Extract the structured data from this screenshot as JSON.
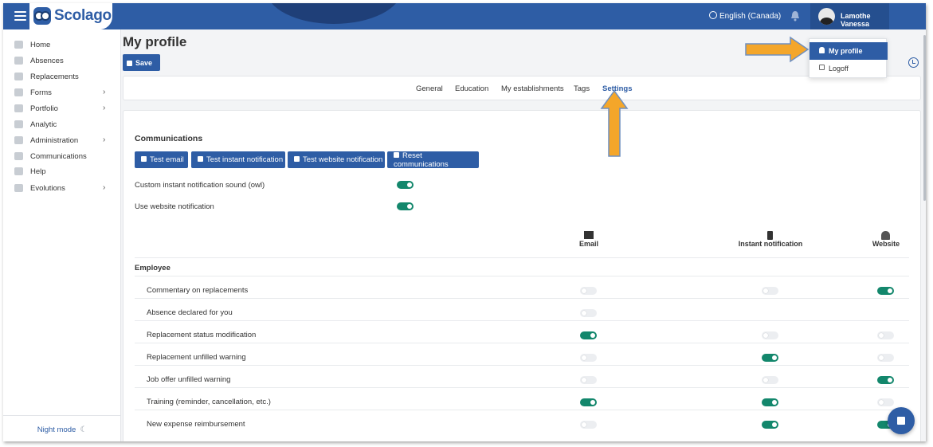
{
  "header": {
    "brand": "Scolago",
    "language": "English (Canada)",
    "user_name": "Lamothe Vanessa"
  },
  "user_menu": {
    "items": [
      {
        "label": "My profile",
        "icon": "user-icon",
        "active": true
      },
      {
        "label": "Logoff",
        "icon": "logout-icon",
        "active": false
      }
    ]
  },
  "sidebar": {
    "items": [
      {
        "label": "Home",
        "icon": "home-icon",
        "expandable": false
      },
      {
        "label": "Absences",
        "icon": "users-icon",
        "expandable": false
      },
      {
        "label": "Replacements",
        "icon": "swap-icon",
        "expandable": false
      },
      {
        "label": "Forms",
        "icon": "form-icon",
        "expandable": true
      },
      {
        "label": "Portfolio",
        "icon": "trophy-icon",
        "expandable": true
      },
      {
        "label": "Analytic",
        "icon": "chart-icon",
        "expandable": false
      },
      {
        "label": "Administration",
        "icon": "gear-icon",
        "expandable": true
      },
      {
        "label": "Communications",
        "icon": "megaphone-icon",
        "expandable": false
      },
      {
        "label": "Help",
        "icon": "question-icon",
        "expandable": false
      },
      {
        "label": "Evolutions",
        "icon": "sprout-icon",
        "expandable": true
      }
    ],
    "night_mode": "Night mode"
  },
  "page": {
    "title": "My profile",
    "save_label": "Save"
  },
  "tabs": [
    {
      "label": "General",
      "active": false
    },
    {
      "label": "Education",
      "active": false
    },
    {
      "label": "My establishments",
      "active": false
    },
    {
      "label": "Tags",
      "active": false
    },
    {
      "label": "Settings",
      "active": true
    }
  ],
  "communications": {
    "title": "Communications",
    "buttons": [
      {
        "label": "Test email",
        "icon": "envelope-icon"
      },
      {
        "label": "Test instant notification",
        "icon": "phone-icon"
      },
      {
        "label": "Test website notification",
        "icon": "bell-icon"
      },
      {
        "label": "Reset communications",
        "icon": "close-icon"
      }
    ],
    "options": [
      {
        "label": "Custom instant notification sound (owl)",
        "on": true
      },
      {
        "label": "Use website notification",
        "on": true
      }
    ],
    "columns": [
      {
        "label": "Email",
        "icon": "envelope-icon"
      },
      {
        "label": "Instant notification",
        "icon": "phone-icon"
      },
      {
        "label": "Website",
        "icon": "bell-icon"
      }
    ],
    "group": "Employee",
    "rows": [
      {
        "label": "Commentary on replacements",
        "email": false,
        "instant": false,
        "website": true
      },
      {
        "label": "Absence declared for you",
        "email": false,
        "instant": null,
        "website": null
      },
      {
        "label": "Replacement status modification",
        "email": true,
        "instant": false,
        "website": false
      },
      {
        "label": "Replacement unfilled warning",
        "email": false,
        "instant": true,
        "website": false
      },
      {
        "label": "Job offer unfilled warning",
        "email": false,
        "instant": false,
        "website": true
      },
      {
        "label": "Training (reminder, cancellation, etc.)",
        "email": true,
        "instant": true,
        "website": false
      },
      {
        "label": "New expense reimbursement",
        "email": false,
        "instant": true,
        "website": true
      }
    ]
  },
  "colors": {
    "primary": "#2e5da5",
    "toggle_on": "#13876c",
    "annotation_arrow": "#f4a62a"
  }
}
